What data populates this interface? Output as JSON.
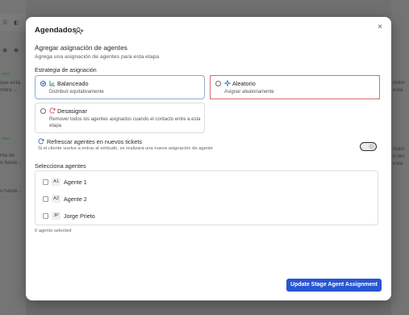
{
  "modal": {
    "title": "Agendados",
    "close_label": "×",
    "heading": "Agregar asignación de agentes",
    "subheading": "Agrega una asignación de agentes para esta etapa",
    "strategy_label": "Estrategia de asignación",
    "strategies": [
      {
        "title": "Balanceado",
        "description": "Distribuir equitativamente",
        "icon": "bar-chart-icon",
        "selected": true
      },
      {
        "title": "Aleatorio",
        "description": "Asignar aleatoriamente",
        "icon": "sparkle-icon",
        "selected": false
      },
      {
        "title": "Desasignar",
        "description": "Remover todos los agentes asignados cuando el contacto entre a esta etapa",
        "icon": "refresh-icon",
        "selected": false
      }
    ],
    "refresh": {
      "title": "Refrescar agentes en nuevos tickets",
      "description": "Si el cliente vuelve a entrar al embudo, se realizará una nueva asignación de agente",
      "enabled": false
    },
    "agents_label": "Selecciona agentes",
    "agents": [
      {
        "initials": "A1",
        "name": "Agente 1",
        "checked": false
      },
      {
        "initials": "A2",
        "name": "Agente 2",
        "checked": false
      },
      {
        "initials": "JP",
        "name": "Jorge Prieto",
        "checked": false
      }
    ],
    "selected_count": "0 agents selected",
    "submit_label": "Update Stage Agent Assignment"
  },
  "background": {
    "left_texts": [
      "que esta",
      "mbre ...",
      "nta de",
      "o haste...",
      "o haste..."
    ],
    "right_texts": [
      "redor",
      "esta",
      "redor",
      "o del",
      "esta"
    ]
  },
  "colors": {
    "accent": "#2955d1",
    "highlight": "#e06b6b",
    "selected_border": "#8fa8d8"
  }
}
